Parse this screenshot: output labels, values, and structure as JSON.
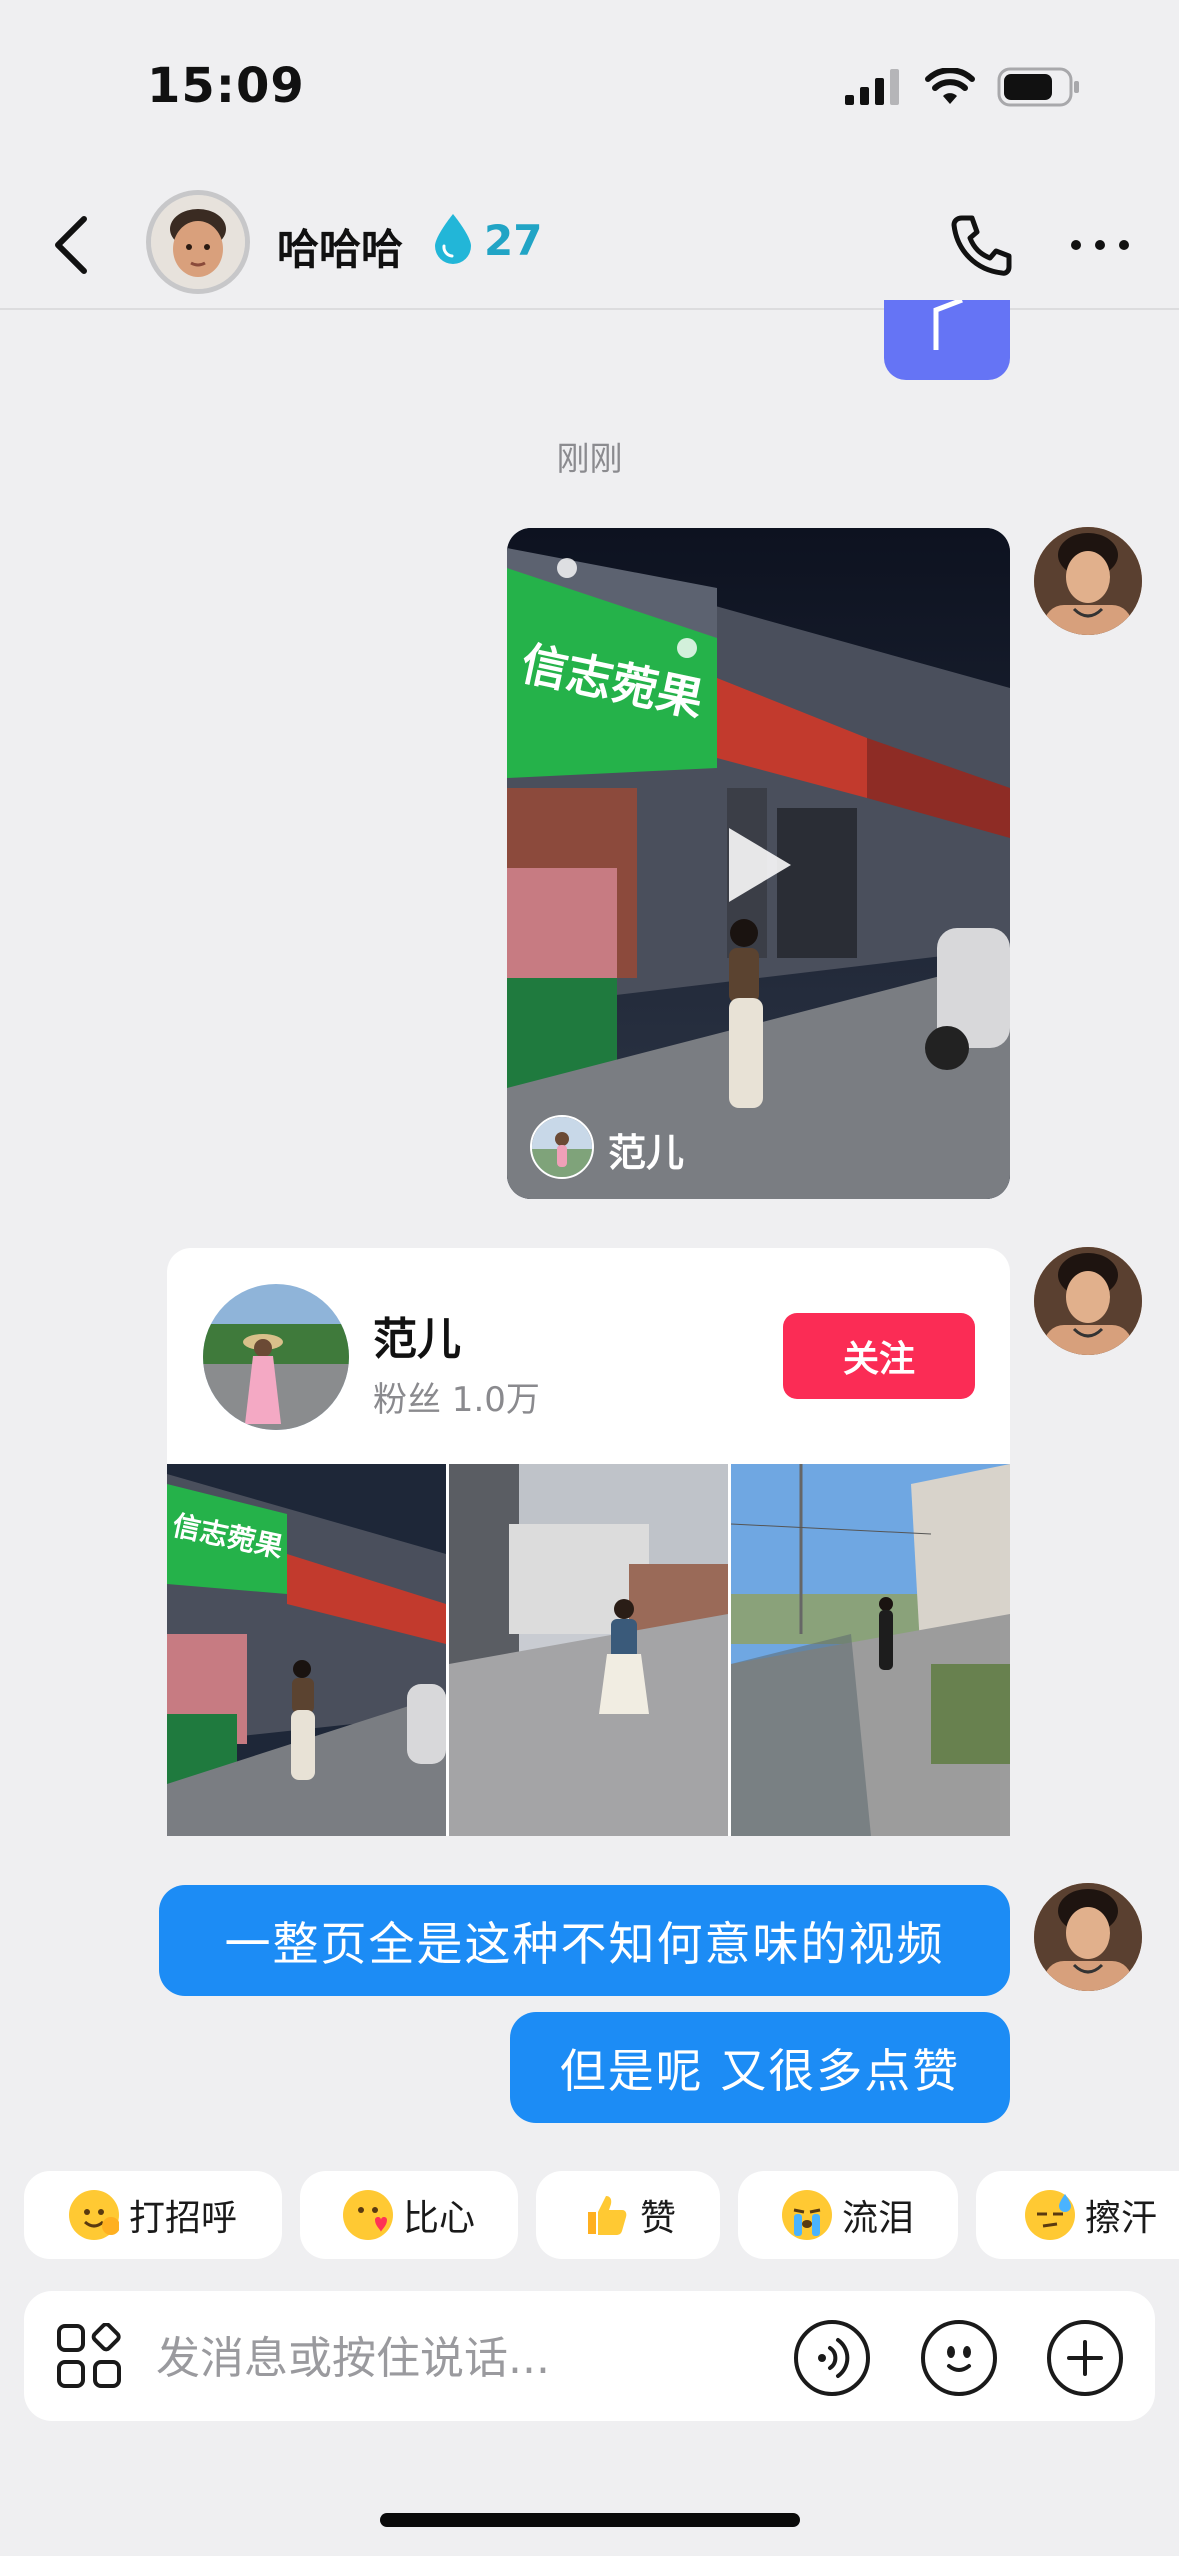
{
  "status_bar": {
    "time": "15:09",
    "icons": [
      "signal-icon",
      "wifi-icon",
      "battery-icon"
    ]
  },
  "header": {
    "contact_name": "哈哈哈",
    "streak_count": "27"
  },
  "chat": {
    "timestamp": "刚刚",
    "video_message": {
      "author_name": "范儿"
    },
    "profile_card": {
      "name": "范儿",
      "fans_label": "粉丝 1.0万",
      "follow_button": "关注"
    },
    "messages": [
      "一整页全是这种不知何意味的视频",
      "但是呢 又很多点赞"
    ]
  },
  "quick_replies": [
    {
      "label": "打招呼",
      "icon": "waving-face-icon"
    },
    {
      "label": "比心",
      "icon": "heart-hands-face-icon"
    },
    {
      "label": "赞",
      "icon": "thumbs-up-icon"
    },
    {
      "label": "流泪",
      "icon": "crying-face-icon"
    },
    {
      "label": "擦汗",
      "icon": "sweating-face-icon"
    }
  ],
  "input": {
    "placeholder": "发消息或按住说话..."
  },
  "colors": {
    "accent_blue": "#1c8cf5",
    "follow_red": "#fb2c55",
    "streak_cyan": "#21a4c5",
    "background": "#efeff1"
  }
}
